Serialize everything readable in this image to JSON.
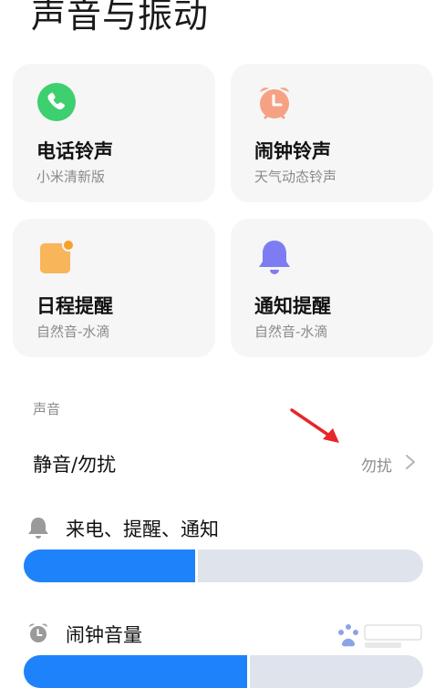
{
  "page": {
    "title": "声音与振动"
  },
  "cards": [
    {
      "id": "phone-ringtone",
      "title": "电话铃声",
      "subtitle": "小米清新版",
      "icon": "phone-icon",
      "icon_color": "#3ecf6f"
    },
    {
      "id": "alarm-ringtone",
      "title": "闹钟铃声",
      "subtitle": "天气动态铃声",
      "icon": "alarm-clock-icon",
      "icon_color": "#f7a184"
    },
    {
      "id": "calendar-reminder",
      "title": "日程提醒",
      "subtitle": "自然音-水滴",
      "icon": "calendar-icon",
      "icon_color": "#f9b55a"
    },
    {
      "id": "notification-reminder",
      "title": "通知提醒",
      "subtitle": "自然音-水滴",
      "icon": "bell-icon",
      "icon_color": "#7e7cf3"
    }
  ],
  "sound_section": {
    "label": "声音",
    "silent_row": {
      "title": "静音/勿扰",
      "value": "勿扰"
    }
  },
  "volumes": [
    {
      "id": "ring",
      "label": "来电、提醒、通知",
      "icon": "bell-icon",
      "level": 0.43
    },
    {
      "id": "alarm",
      "label": "闹钟音量",
      "icon": "alarm-clock-icon",
      "level": 0.56
    }
  ],
  "colors": {
    "slider_fill": "#1e82fb",
    "slider_track": "#dfe3ec",
    "annotation_arrow": "#e8262a"
  }
}
